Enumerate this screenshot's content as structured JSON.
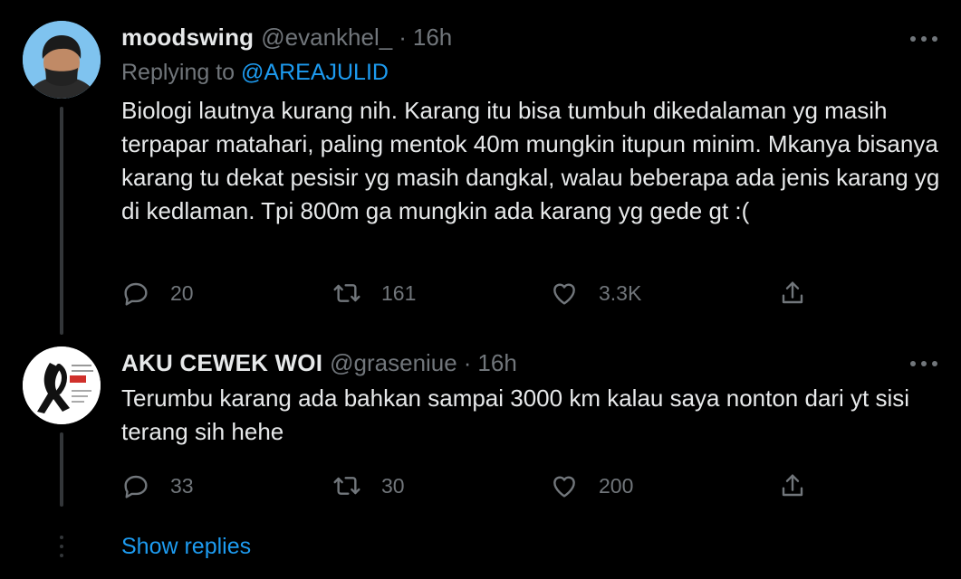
{
  "tweets": [
    {
      "author_name": "moodswing",
      "handle": "@evankhel_",
      "separator": "·",
      "time": "16h",
      "replying_prefix": "Replying to",
      "replying_to": "@AREAJULID",
      "text": "Biologi lautnya kurang nih. Karang itu bisa tumbuh dikedalaman yg masih terpapar matahari, paling mentok 40m mungkin itupun minim. Mkanya bisanya karang tu dekat pesisir yg masih dangkal, walau beberapa ada jenis karang yg di kedlaman. Tpi 800m ga mungkin ada karang yg gede gt :(",
      "replies": "20",
      "retweets": "161",
      "likes": "3.3K"
    },
    {
      "author_name": "AKU CEWEK WOI",
      "handle": "@graseniue",
      "separator": "·",
      "time": "16h",
      "text": "Terumbu karang ada bahkan sampai 3000 km kalau saya nonton dari yt sisi terang sih hehe",
      "replies": "33",
      "retweets": "30",
      "likes": "200"
    }
  ],
  "show_replies_label": "Show replies",
  "colors": {
    "background": "#000000",
    "text_primary": "#e7e9ea",
    "text_secondary": "#71767b",
    "accent": "#1d9bf0",
    "thread_line": "#333639"
  },
  "icons": [
    "ellipsis-icon",
    "reply-icon",
    "retweet-icon",
    "like-icon",
    "share-icon"
  ]
}
